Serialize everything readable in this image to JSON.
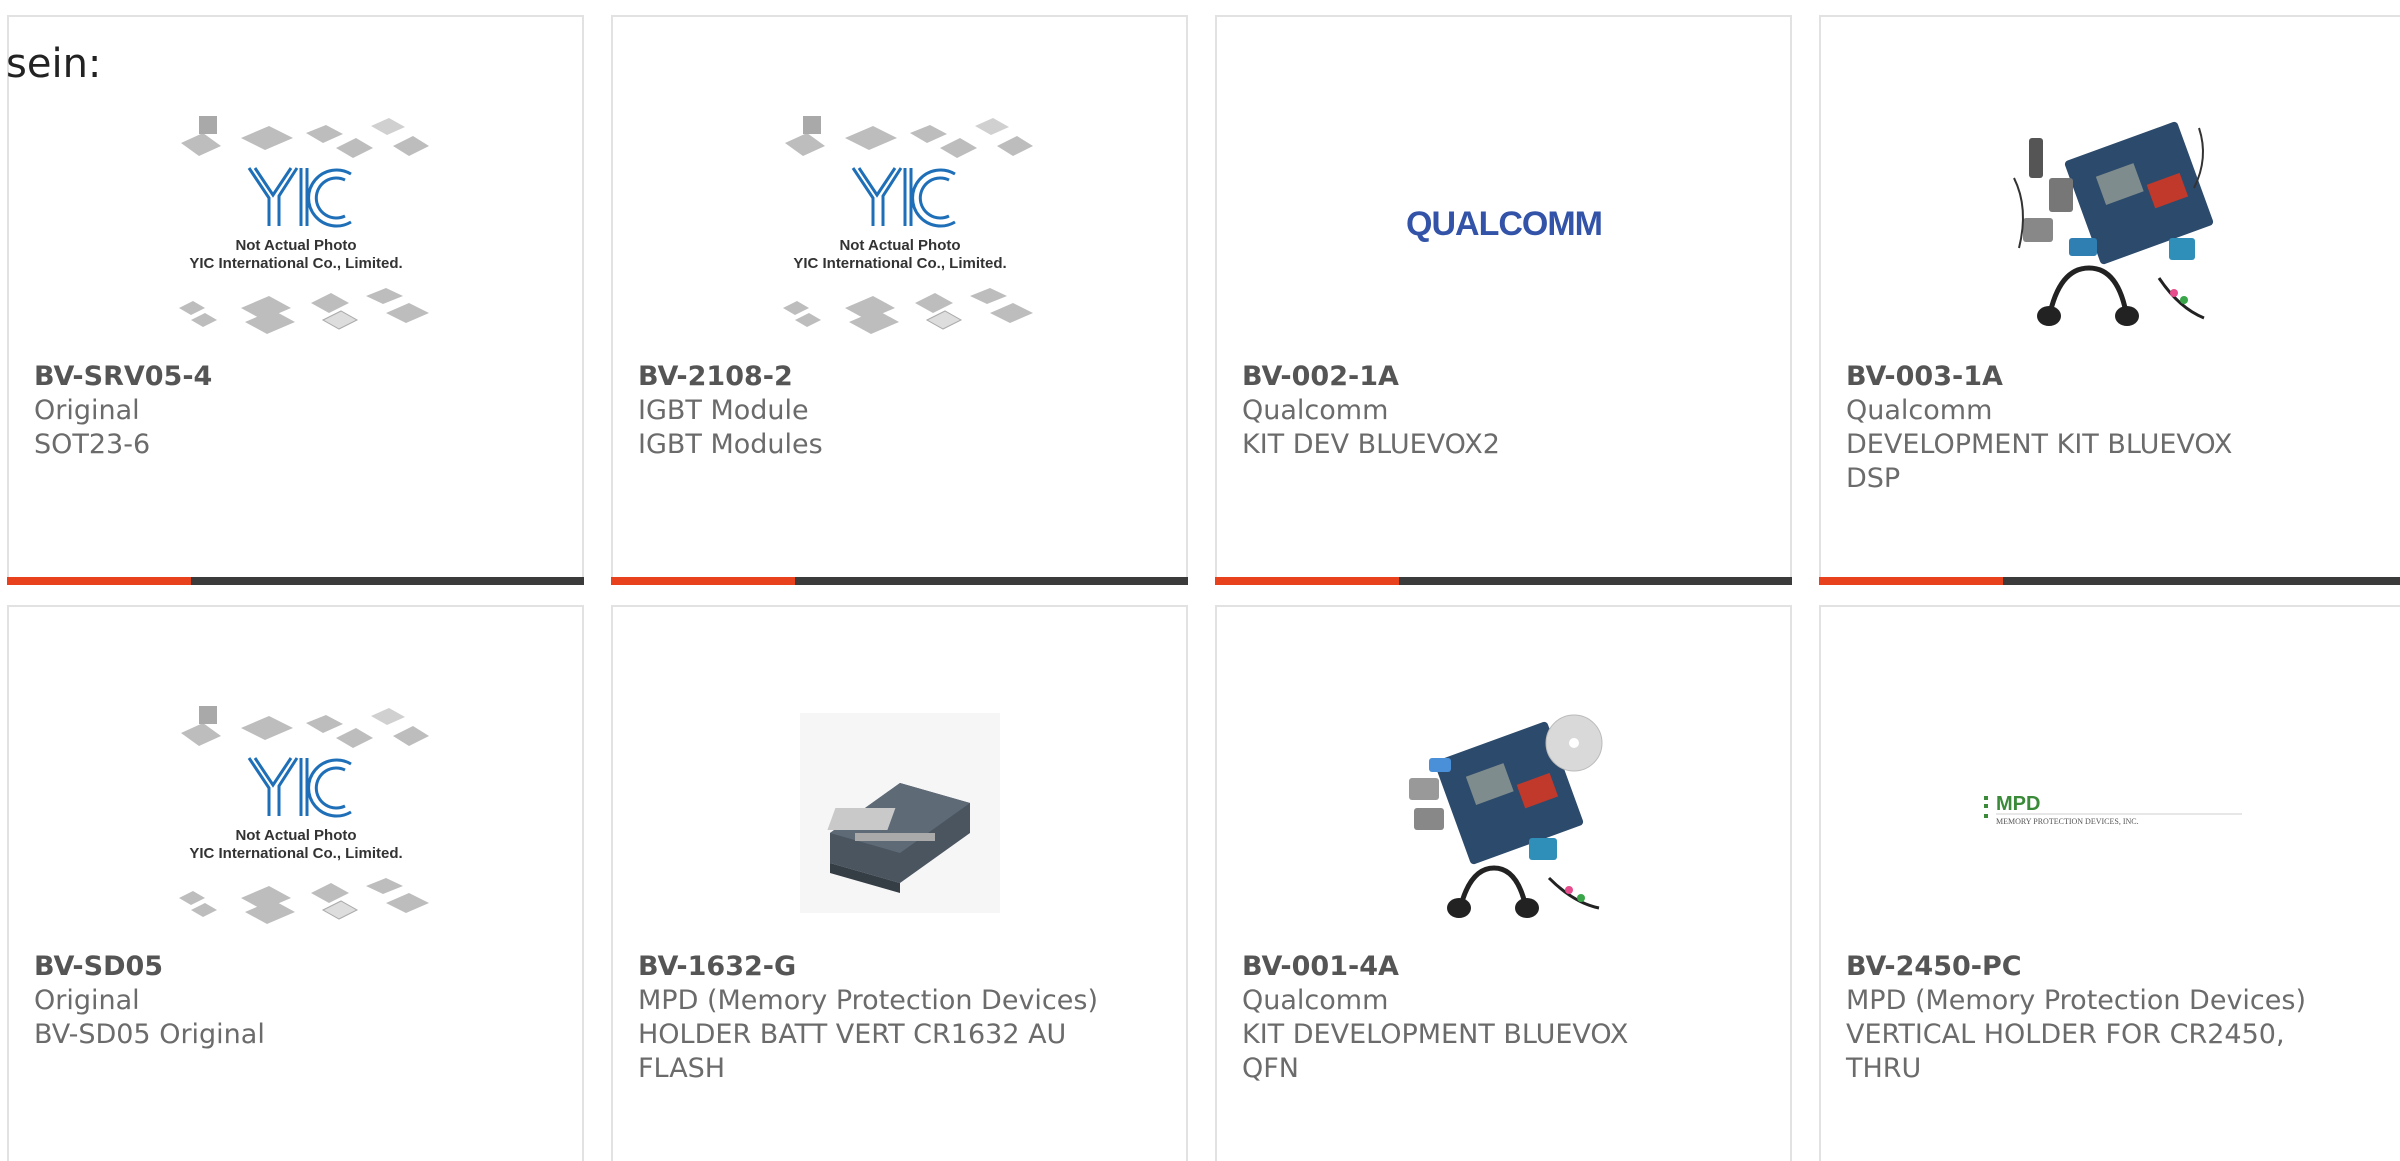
{
  "lead_text": "sein:",
  "placeholder_image": {
    "line1": "Not Actual Photo",
    "line2": "YIC International Co., Limited."
  },
  "logos": {
    "qualcomm": "QUALCOMM",
    "mpd_main": "MPD",
    "mpd_sub": "MEMORY PROTECTION DEVICES, INC."
  },
  "colors": {
    "accent": "#e8411d",
    "bar": "#3b3b3b",
    "yic_blue": "#1e6fb8",
    "qualcomm_blue": "#3253a8",
    "mpd_green": "#3a8a3a"
  },
  "products": [
    {
      "part": "BV-SRV05-4",
      "maker": "Original",
      "desc": "SOT23-6",
      "image": "yic-placeholder"
    },
    {
      "part": "BV-2108-2",
      "maker": "IGBT Module",
      "desc": "IGBT Modules",
      "image": "yic-placeholder"
    },
    {
      "part": "BV-002-1A",
      "maker": "Qualcomm",
      "desc": "KIT DEV BLUEVOX2",
      "image": "qualcomm-logo"
    },
    {
      "part": "BV-003-1A",
      "maker": "Qualcomm",
      "desc": "DEVELOPMENT KIT BLUEVOX DSP",
      "image": "dev-kit-photo"
    },
    {
      "part": "BV-SD05",
      "maker": "Original",
      "desc": "BV-SD05 Original",
      "image": "yic-placeholder"
    },
    {
      "part": "BV-1632-G",
      "maker": "MPD (Memory Protection Devices)",
      "desc": "HOLDER BATT VERT CR1632 AU FLASH",
      "image": "battery-holder-photo"
    },
    {
      "part": "BV-001-4A",
      "maker": "Qualcomm",
      "desc": "KIT DEVELOPMENT BLUEVOX QFN",
      "image": "dev-kit-photo"
    },
    {
      "part": "BV-2450-PC",
      "maker": "MPD (Memory Protection Devices)",
      "desc": "VERTICAL HOLDER FOR CR2450, THRU",
      "image": "mpd-logo"
    }
  ]
}
